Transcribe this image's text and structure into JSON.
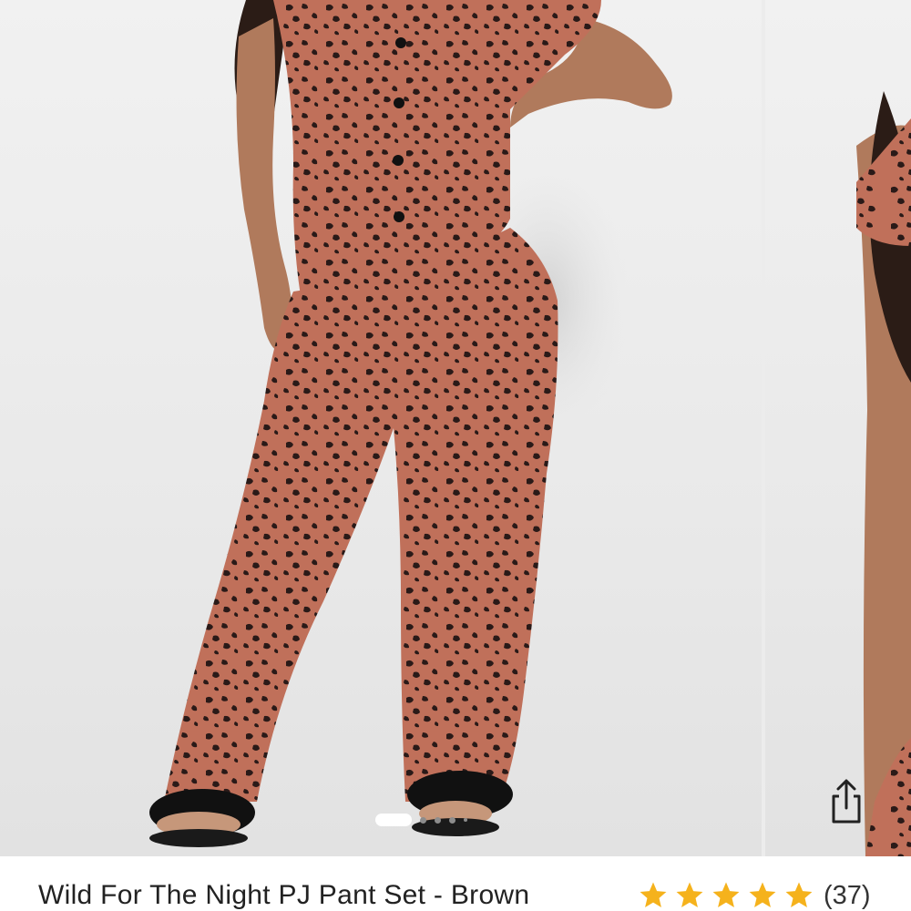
{
  "product": {
    "title": "Wild For The Night PJ Pant Set - Brown",
    "rating": {
      "stars": 5,
      "review_count_label": "(37)"
    }
  },
  "gallery": {
    "current_index": 1,
    "total_indicators": 5,
    "share_icon": "share-upload-icon"
  },
  "colors": {
    "background": "#ececec",
    "print_base": "#c0705a",
    "print_spots": "#2a1a18",
    "star": "#f5b21c",
    "text": "#222222"
  }
}
